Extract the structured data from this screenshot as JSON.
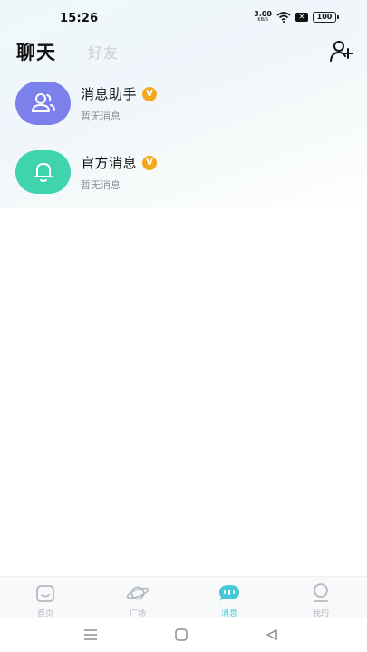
{
  "status_bar": {
    "time": "15:26",
    "net_speed_value": "3.00",
    "net_speed_unit": "KB/S",
    "sim_icon": "x-icon",
    "battery": "100"
  },
  "header": {
    "tabs": [
      {
        "label": "聊天",
        "active": true
      },
      {
        "label": "好友",
        "active": false
      }
    ],
    "add_friend_icon": "add-user-icon"
  },
  "chats": [
    {
      "title": "消息助手",
      "badge": "V",
      "preview": "暂无消息",
      "icon": "users-icon",
      "color": "#7b80ea"
    },
    {
      "title": "官方消息",
      "badge": "V",
      "preview": "暂无消息",
      "icon": "bell-icon",
      "color": "#3fd3ae"
    }
  ],
  "tabbar": {
    "items": [
      {
        "label": "首页",
        "icon": "home-icon",
        "active": false
      },
      {
        "label": "广场",
        "icon": "planet-icon",
        "active": false
      },
      {
        "label": "消息",
        "icon": "chat-bubble-icon",
        "active": true
      },
      {
        "label": "我的",
        "icon": "profile-icon",
        "active": false
      }
    ],
    "active_color": "#45c9d6"
  },
  "nav": {
    "buttons": [
      "menu-icon",
      "home-square-icon",
      "back-triangle-icon"
    ]
  }
}
